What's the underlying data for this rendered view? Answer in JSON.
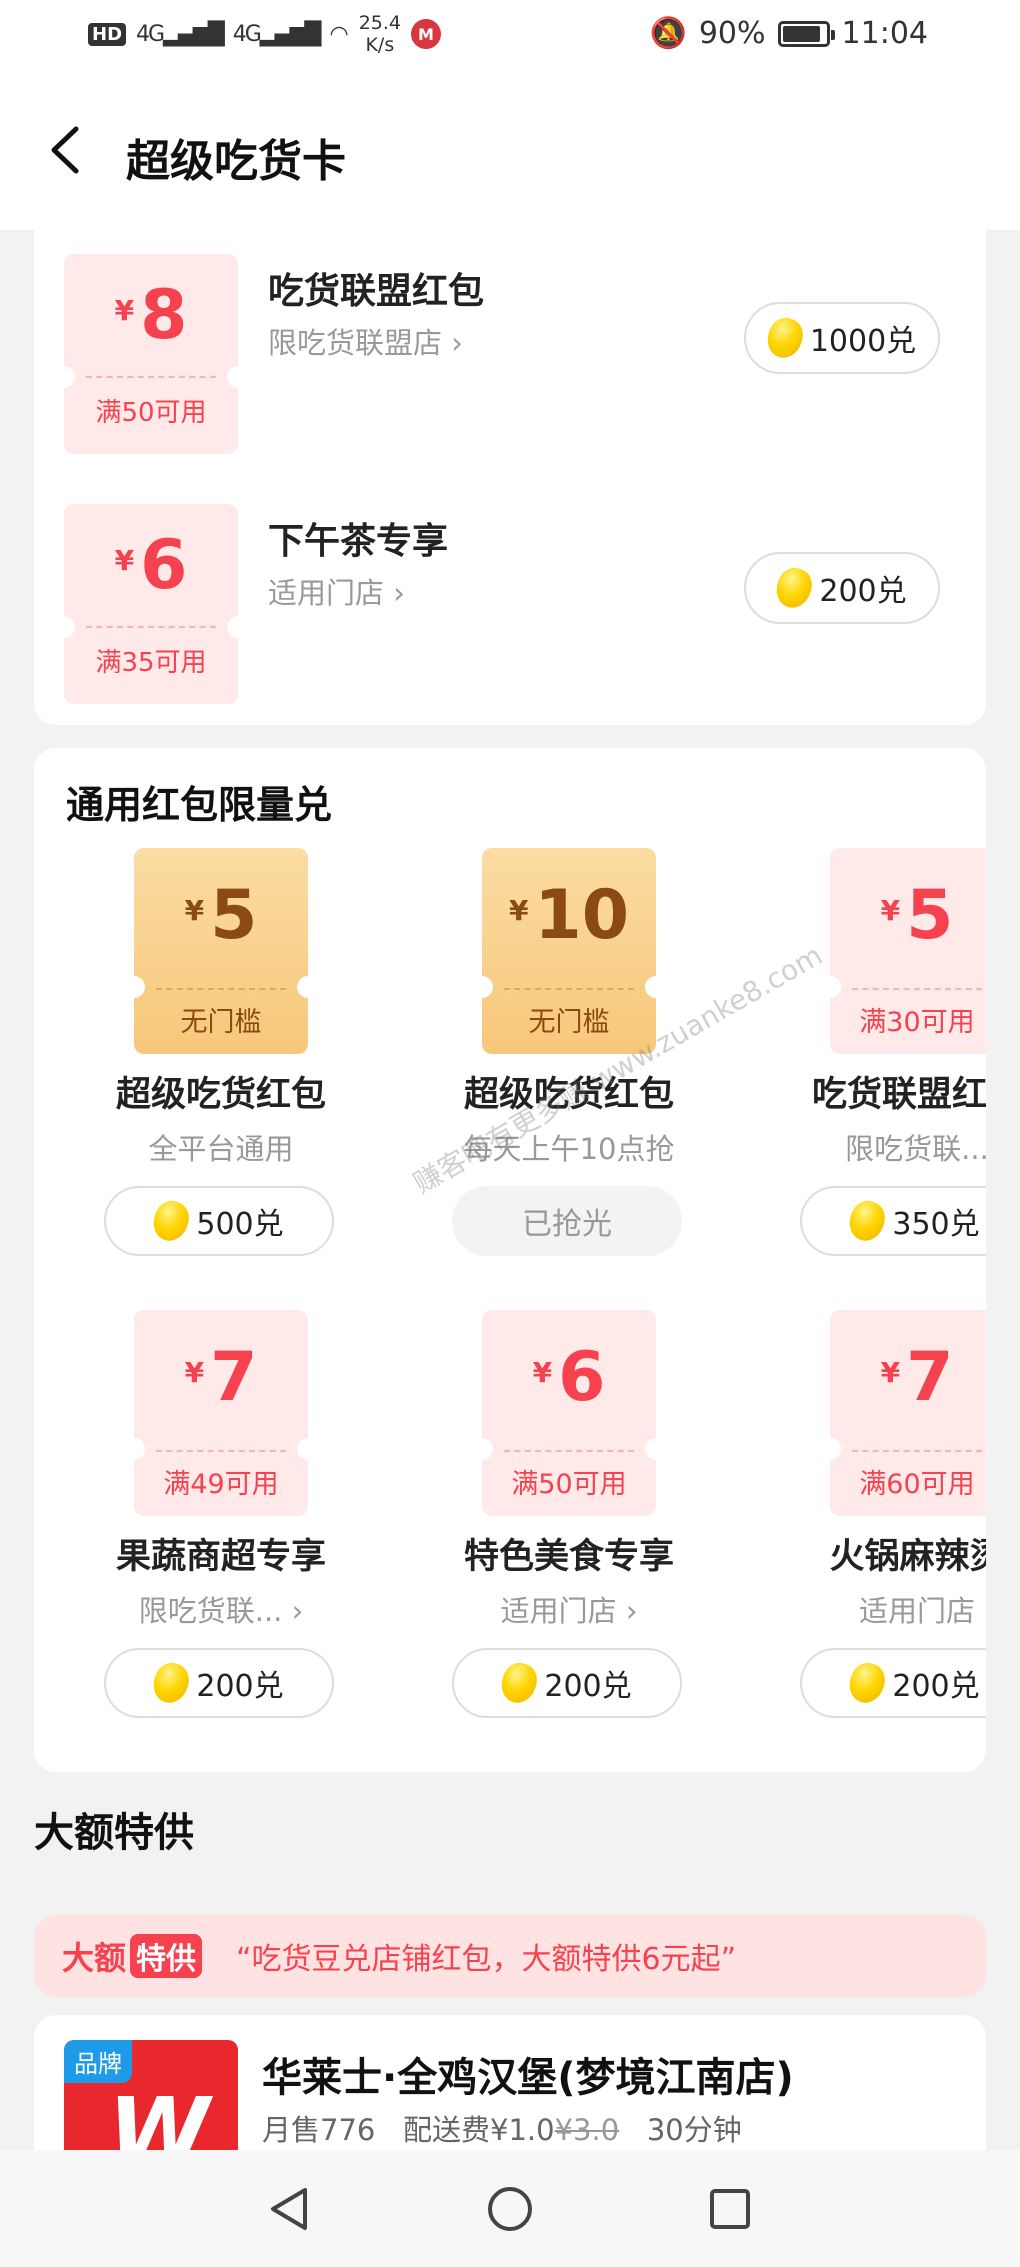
{
  "status_bar": {
    "network": "4G",
    "speed_value": "25.4",
    "speed_unit": "K/s",
    "battery": "90%",
    "time": "11:04"
  },
  "header": {
    "title": "超级吃货卡"
  },
  "store_coupons": [
    {
      "amount": "8",
      "currency": "¥",
      "condition": "满50可用",
      "title": "吃货联盟红包",
      "subtitle": "限吃货联盟店",
      "price": "1000兑"
    },
    {
      "amount": "6",
      "currency": "¥",
      "condition": "满35可用",
      "title": "下午茶专享",
      "subtitle": "适用门店",
      "price": "200兑"
    }
  ],
  "general": {
    "title": "通用红包限量兑",
    "items": [
      {
        "amount": "5",
        "currency": "¥",
        "condition": "无门槛",
        "title": "超级吃货红包",
        "subtitle": "全平台通用",
        "action": "500兑",
        "style": "gold"
      },
      {
        "amount": "10",
        "currency": "¥",
        "condition": "无门槛",
        "title": "超级吃货红包",
        "subtitle": "每天上午10点抢",
        "action": "已抢光",
        "style": "gold"
      },
      {
        "amount": "5",
        "currency": "¥",
        "condition": "满30可用",
        "title": "吃货联盟红包",
        "subtitle": "限吃货联...",
        "action": "350兑",
        "style": "pink"
      },
      {
        "amount": "7",
        "currency": "¥",
        "condition": "满49可用",
        "title": "果蔬商超专享",
        "subtitle": "限吃货联...",
        "action": "200兑",
        "style": "pink"
      },
      {
        "amount": "6",
        "currency": "¥",
        "condition": "满50可用",
        "title": "特色美食专享",
        "subtitle": "适用门店",
        "action": "200兑",
        "style": "pink"
      },
      {
        "amount": "7",
        "currency": "¥",
        "condition": "满60可用",
        "title": "火锅麻辣烫",
        "subtitle": "适用门店",
        "action": "200兑",
        "style": "pink"
      }
    ]
  },
  "big_deal": {
    "section_title": "大额特供",
    "tag_a": "大额",
    "tag_b": "特供",
    "banner_text": "“吃货豆兑店铺红包，大额特供6元起”"
  },
  "shop": {
    "badge": "品牌",
    "logo_letter": "W",
    "name": "华莱士·全鸡汉堡(梦境江南店)",
    "monthly_sales": "月售776",
    "delivery_fee": "配送费¥1.0",
    "original_fee": "¥3.0",
    "delivery_time": "30分钟"
  },
  "watermark": "赚客吧有更多赚 www.zuanke8.com",
  "colors": {
    "accent": "#f5424e",
    "gold_text": "#8b4a12",
    "bean": "#ffd400"
  }
}
